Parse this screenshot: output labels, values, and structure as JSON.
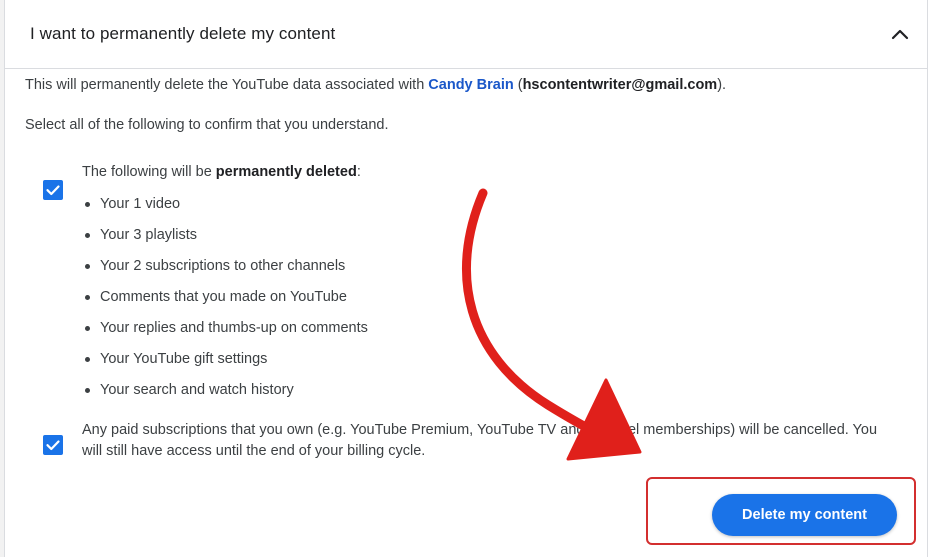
{
  "section": {
    "title": "I want to permanently delete my content",
    "collapse_icon": "chevron-up-icon"
  },
  "description": {
    "prefix": "This will permanently delete the YouTube data associated with ",
    "account_name": "Candy Brain",
    "open_paren": " (",
    "email": "hscontentwriter@gmail.com",
    "suffix": ")."
  },
  "confirm_prompt": "Select all of the following to confirm that you understand.",
  "confirm_block_1": {
    "checked": true,
    "intro_prefix": "The following will be ",
    "intro_bold": "permanently deleted",
    "intro_suffix": ":",
    "items": [
      "Your 1 video",
      "Your 3 playlists",
      "Your 2 subscriptions to other channels",
      "Comments that you made on YouTube",
      "Your replies and thumbs-up on comments",
      "Your YouTube gift settings",
      "Your search and watch history"
    ]
  },
  "confirm_block_2": {
    "checked": true,
    "text": "Any paid subscriptions that you own (e.g. YouTube Premium, YouTube TV and channel memberships) will be cancelled. You will still have access until the end of your billing cycle."
  },
  "actions": {
    "delete_label": "Delete my content"
  },
  "colors": {
    "accent": "#1a73e8",
    "annotation": "#e0201b"
  }
}
